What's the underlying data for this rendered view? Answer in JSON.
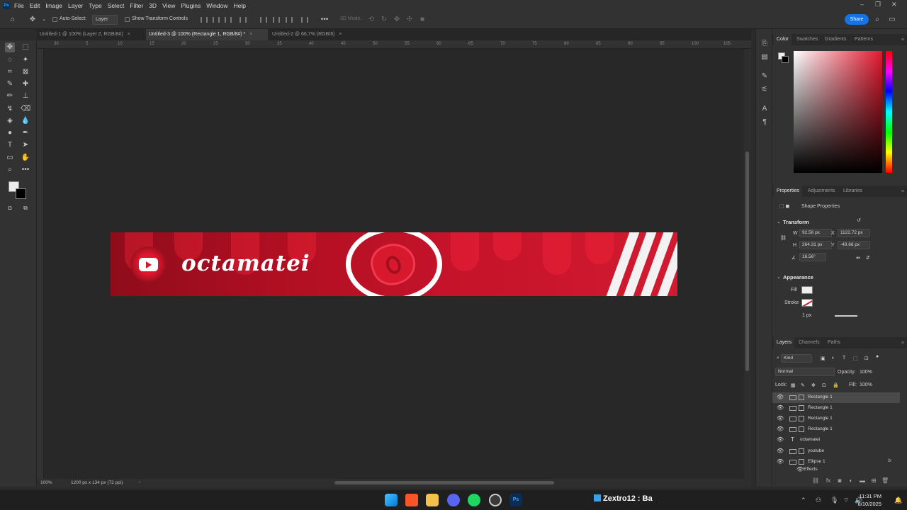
{
  "app": {
    "menu": [
      "File",
      "Edit",
      "Image",
      "Layer",
      "Type",
      "Select",
      "Filter",
      "3D",
      "View",
      "Plugins",
      "Window",
      "Help"
    ],
    "logo": "Ps"
  },
  "options": {
    "auto_select_label": "Auto-Select:",
    "auto_select_value": "Layer",
    "transform_label": "Show Transform Controls",
    "mode_label": "3D Mode:",
    "share_label": "Share"
  },
  "tabs": [
    {
      "label": "Untitled-1 @ 100% (Layer 2, RGB/8#)",
      "active": false
    },
    {
      "label": "Untitled-3 @ 100% (Rectangle 1, RGB/8#) *",
      "active": true
    },
    {
      "label": "Untitled-2 @ 66,7% (RGB/8)",
      "active": false
    }
  ],
  "ruler_labels": [
    "30",
    "5",
    "10",
    "15",
    "20",
    "25",
    "30",
    "35",
    "40",
    "45",
    "50",
    "55",
    "60",
    "65",
    "70",
    "75",
    "80",
    "85",
    "90",
    "95",
    "100",
    "105"
  ],
  "canvas": {
    "banner_text": "octamatei"
  },
  "status": {
    "zoom": "100%",
    "doc_info": "1200 px x 134 px (72 ppi)"
  },
  "color_panel": {
    "tabs": [
      "Color",
      "Swatches",
      "Gradients",
      "Patterns"
    ]
  },
  "properties": {
    "tabs": [
      "Properties",
      "Adjustments",
      "Libraries"
    ],
    "subtitle": "Shape Properties",
    "transform_title": "Transform",
    "w_label": "W",
    "w_value": "92.56 px",
    "x_label": "X",
    "x_value": "1122.72 px",
    "h_label": "H",
    "h_value": "264.31 px",
    "y_label": "Y",
    "y_value": "-49.66 px",
    "angle_value": "16.56°",
    "appearance_title": "Appearance",
    "fill_label": "Fill",
    "stroke_label": "Stroke",
    "stroke_width": "1 px"
  },
  "layers_panel": {
    "tabs": [
      "Layers",
      "Channels",
      "Paths"
    ],
    "filter_label": "Kind",
    "blend_mode": "Normal",
    "opacity_label": "Opacity:",
    "opacity_value": "100%",
    "lock_label": "Lock:",
    "fill_label": "Fill:",
    "fill_value": "100%",
    "layers": [
      {
        "name": "Rectangle 1",
        "selected": true
      },
      {
        "name": "Rectangle 1",
        "selected": false
      },
      {
        "name": "Rectangle 1",
        "selected": false
      },
      {
        "name": "Rectangle 1",
        "selected": false
      },
      {
        "name": "octamatei",
        "selected": false,
        "type": "text"
      },
      {
        "name": "youtube",
        "selected": false
      },
      {
        "name": "Ellipse 1",
        "selected": false,
        "fx": "fx"
      }
    ],
    "effects_label": "Effects"
  },
  "taskbar": {
    "active_label": "Zextro12 : Ba",
    "time": "11:31 PM",
    "date": "8/10/2025"
  },
  "colors": {
    "accent": "#1473e6",
    "banner_red": "#c5132a"
  }
}
